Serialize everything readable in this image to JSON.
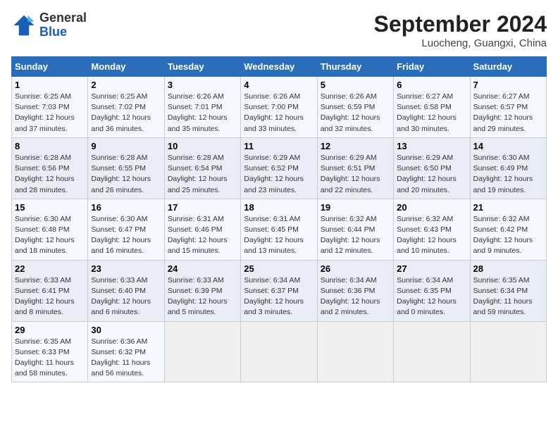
{
  "header": {
    "logo_line1": "General",
    "logo_line2": "Blue",
    "month_year": "September 2024",
    "location": "Luocheng, Guangxi, China"
  },
  "days_of_week": [
    "Sunday",
    "Monday",
    "Tuesday",
    "Wednesday",
    "Thursday",
    "Friday",
    "Saturday"
  ],
  "weeks": [
    [
      {
        "day": "1",
        "detail": "Sunrise: 6:25 AM\nSunset: 7:03 PM\nDaylight: 12 hours\nand 37 minutes."
      },
      {
        "day": "2",
        "detail": "Sunrise: 6:25 AM\nSunset: 7:02 PM\nDaylight: 12 hours\nand 36 minutes."
      },
      {
        "day": "3",
        "detail": "Sunrise: 6:26 AM\nSunset: 7:01 PM\nDaylight: 12 hours\nand 35 minutes."
      },
      {
        "day": "4",
        "detail": "Sunrise: 6:26 AM\nSunset: 7:00 PM\nDaylight: 12 hours\nand 33 minutes."
      },
      {
        "day": "5",
        "detail": "Sunrise: 6:26 AM\nSunset: 6:59 PM\nDaylight: 12 hours\nand 32 minutes."
      },
      {
        "day": "6",
        "detail": "Sunrise: 6:27 AM\nSunset: 6:58 PM\nDaylight: 12 hours\nand 30 minutes."
      },
      {
        "day": "7",
        "detail": "Sunrise: 6:27 AM\nSunset: 6:57 PM\nDaylight: 12 hours\nand 29 minutes."
      }
    ],
    [
      {
        "day": "8",
        "detail": "Sunrise: 6:28 AM\nSunset: 6:56 PM\nDaylight: 12 hours\nand 28 minutes."
      },
      {
        "day": "9",
        "detail": "Sunrise: 6:28 AM\nSunset: 6:55 PM\nDaylight: 12 hours\nand 26 minutes."
      },
      {
        "day": "10",
        "detail": "Sunrise: 6:28 AM\nSunset: 6:54 PM\nDaylight: 12 hours\nand 25 minutes."
      },
      {
        "day": "11",
        "detail": "Sunrise: 6:29 AM\nSunset: 6:52 PM\nDaylight: 12 hours\nand 23 minutes."
      },
      {
        "day": "12",
        "detail": "Sunrise: 6:29 AM\nSunset: 6:51 PM\nDaylight: 12 hours\nand 22 minutes."
      },
      {
        "day": "13",
        "detail": "Sunrise: 6:29 AM\nSunset: 6:50 PM\nDaylight: 12 hours\nand 20 minutes."
      },
      {
        "day": "14",
        "detail": "Sunrise: 6:30 AM\nSunset: 6:49 PM\nDaylight: 12 hours\nand 19 minutes."
      }
    ],
    [
      {
        "day": "15",
        "detail": "Sunrise: 6:30 AM\nSunset: 6:48 PM\nDaylight: 12 hours\nand 18 minutes."
      },
      {
        "day": "16",
        "detail": "Sunrise: 6:30 AM\nSunset: 6:47 PM\nDaylight: 12 hours\nand 16 minutes."
      },
      {
        "day": "17",
        "detail": "Sunrise: 6:31 AM\nSunset: 6:46 PM\nDaylight: 12 hours\nand 15 minutes."
      },
      {
        "day": "18",
        "detail": "Sunrise: 6:31 AM\nSunset: 6:45 PM\nDaylight: 12 hours\nand 13 minutes."
      },
      {
        "day": "19",
        "detail": "Sunrise: 6:32 AM\nSunset: 6:44 PM\nDaylight: 12 hours\nand 12 minutes."
      },
      {
        "day": "20",
        "detail": "Sunrise: 6:32 AM\nSunset: 6:43 PM\nDaylight: 12 hours\nand 10 minutes."
      },
      {
        "day": "21",
        "detail": "Sunrise: 6:32 AM\nSunset: 6:42 PM\nDaylight: 12 hours\nand 9 minutes."
      }
    ],
    [
      {
        "day": "22",
        "detail": "Sunrise: 6:33 AM\nSunset: 6:41 PM\nDaylight: 12 hours\nand 8 minutes."
      },
      {
        "day": "23",
        "detail": "Sunrise: 6:33 AM\nSunset: 6:40 PM\nDaylight: 12 hours\nand 6 minutes."
      },
      {
        "day": "24",
        "detail": "Sunrise: 6:33 AM\nSunset: 6:39 PM\nDaylight: 12 hours\nand 5 minutes."
      },
      {
        "day": "25",
        "detail": "Sunrise: 6:34 AM\nSunset: 6:37 PM\nDaylight: 12 hours\nand 3 minutes."
      },
      {
        "day": "26",
        "detail": "Sunrise: 6:34 AM\nSunset: 6:36 PM\nDaylight: 12 hours\nand 2 minutes."
      },
      {
        "day": "27",
        "detail": "Sunrise: 6:34 AM\nSunset: 6:35 PM\nDaylight: 12 hours\nand 0 minutes."
      },
      {
        "day": "28",
        "detail": "Sunrise: 6:35 AM\nSunset: 6:34 PM\nDaylight: 11 hours\nand 59 minutes."
      }
    ],
    [
      {
        "day": "29",
        "detail": "Sunrise: 6:35 AM\nSunset: 6:33 PM\nDaylight: 11 hours\nand 58 minutes."
      },
      {
        "day": "30",
        "detail": "Sunrise: 6:36 AM\nSunset: 6:32 PM\nDaylight: 11 hours\nand 56 minutes."
      },
      {
        "day": "",
        "detail": ""
      },
      {
        "day": "",
        "detail": ""
      },
      {
        "day": "",
        "detail": ""
      },
      {
        "day": "",
        "detail": ""
      },
      {
        "day": "",
        "detail": ""
      }
    ]
  ]
}
